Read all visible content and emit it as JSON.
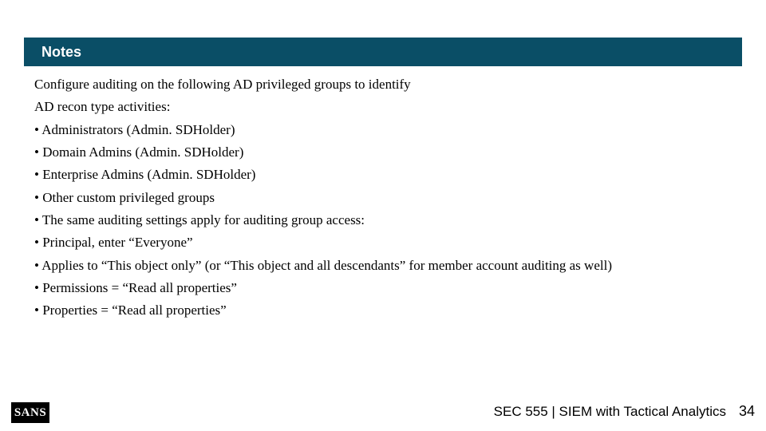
{
  "title": "Notes",
  "intro_lines": [
    "Configure auditing on the following AD privileged groups to identify",
    "AD recon type activities:"
  ],
  "bullets": [
    "Administrators (Admin. SDHolder)",
    "Domain Admins (Admin. SDHolder)",
    "Enterprise Admins (Admin. SDHolder)",
    "Other custom privileged groups",
    "The same auditing settings apply for auditing group access:",
    "Principal, enter “Everyone”",
    "Applies to “This object only” (or “This object and all descendants” for member account auditing as well)",
    "Permissions = “Read all properties”",
    "Properties = “Read all properties”"
  ],
  "bullet_prefix": "• ",
  "footer": {
    "logo": "SANS",
    "course": "SEC 555 | SIEM with Tactical Analytics",
    "page": "34"
  }
}
